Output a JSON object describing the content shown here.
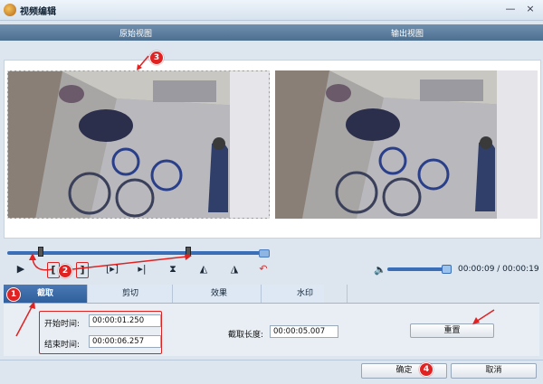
{
  "window": {
    "title": "视频编辑",
    "min_glyph": "—",
    "close_glyph": "×"
  },
  "views": {
    "original_label": "原始视图",
    "output_label": "输出视图"
  },
  "controls": {
    "play_glyph": "▶",
    "bracket_start": "[",
    "bracket_end": "]",
    "step_glyph": "[▸]",
    "glyphs": [
      "▸|",
      "⧗",
      "◭",
      "◮",
      "↶"
    ]
  },
  "playback": {
    "time": "00:00:09 / 00:00:19",
    "volume_fraction": 0.92,
    "start_fraction": 0.13,
    "end_fraction": 0.7
  },
  "tabs": [
    {
      "label": "截取",
      "active": true
    },
    {
      "label": "剪切",
      "active": false
    },
    {
      "label": "效果",
      "active": false
    },
    {
      "label": "水印",
      "active": false
    }
  ],
  "crop": {
    "start_label": "开始时间:",
    "start_value": "00:00:01.250",
    "end_label": "结束时间:",
    "end_value": "00:00:06.257",
    "length_label": "截取长度:",
    "length_value": "00:00:05.007",
    "reset_label": "重置"
  },
  "footer": {
    "ok_label": "确定",
    "cancel_label": "取消"
  },
  "annotations": [
    "1",
    "2",
    "3",
    "4"
  ],
  "colors": {
    "accent": "#3a6fb7",
    "annotation": "#e02222",
    "header": "#5a7b9c"
  }
}
